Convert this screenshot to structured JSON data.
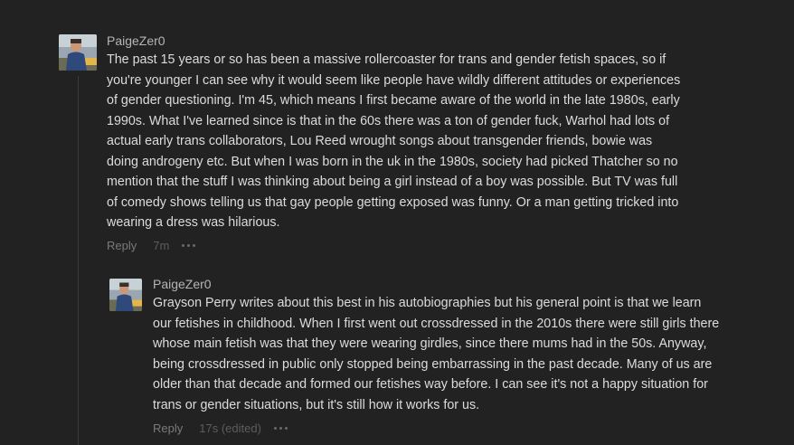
{
  "comments": [
    {
      "username": "PaigeZer0",
      "lines": [
        "The past 15 years or so has been a massive rollercoaster for trans and gender fetish spaces, so if",
        "you're younger I can see why it would seem like people have wildly different attitudes or experiences",
        "of gender questioning. I'm 45, which means I first became aware of the world in the late 1980s, early",
        "1990s. What I've learned since is that in the 60s there was a ton of gender fuck, Warhol had lots of",
        "actual early trans collaborators, Lou Reed wrought songs about transgender friends, bowie was",
        "doing androgeny etc. But when I was born in the uk in the 1980s, society had picked Thatcher so no",
        "mention that the stuff I was thinking about being a girl instead of a boy was possible. But TV was full",
        "of comedy shows telling us that gay people getting exposed was funny. Or a man getting tricked into",
        "wearing a dress was hilarious."
      ],
      "reply_label": "Reply",
      "time": "7m",
      "more_icon": "more-horizontal-icon"
    },
    {
      "username": "PaigeZer0",
      "lines": [
        "Grayson Perry writes about this best in his autobiographies but his general point is that we learn",
        "our fetishes in childhood. When I first went out crossdressed in the 2010s there were still girls there",
        "whose main fetish was that they were wearing girdles, since there mums had in the 50s. Anyway,",
        "being crossdressed in public only stopped being embarrassing in the past decade. Many of us are",
        "older than that decade and formed our fetishes way before. I can see it's not a happy situation for",
        "trans or gender situations, but it's still how it works for us."
      ],
      "reply_label": "Reply",
      "time": "17s (edited)",
      "more_icon": "more-horizontal-icon"
    }
  ],
  "colors": {
    "background": "#222222",
    "text": "#dcdcdc",
    "username": "#b5b5b5",
    "muted": "#6f6f6f"
  }
}
